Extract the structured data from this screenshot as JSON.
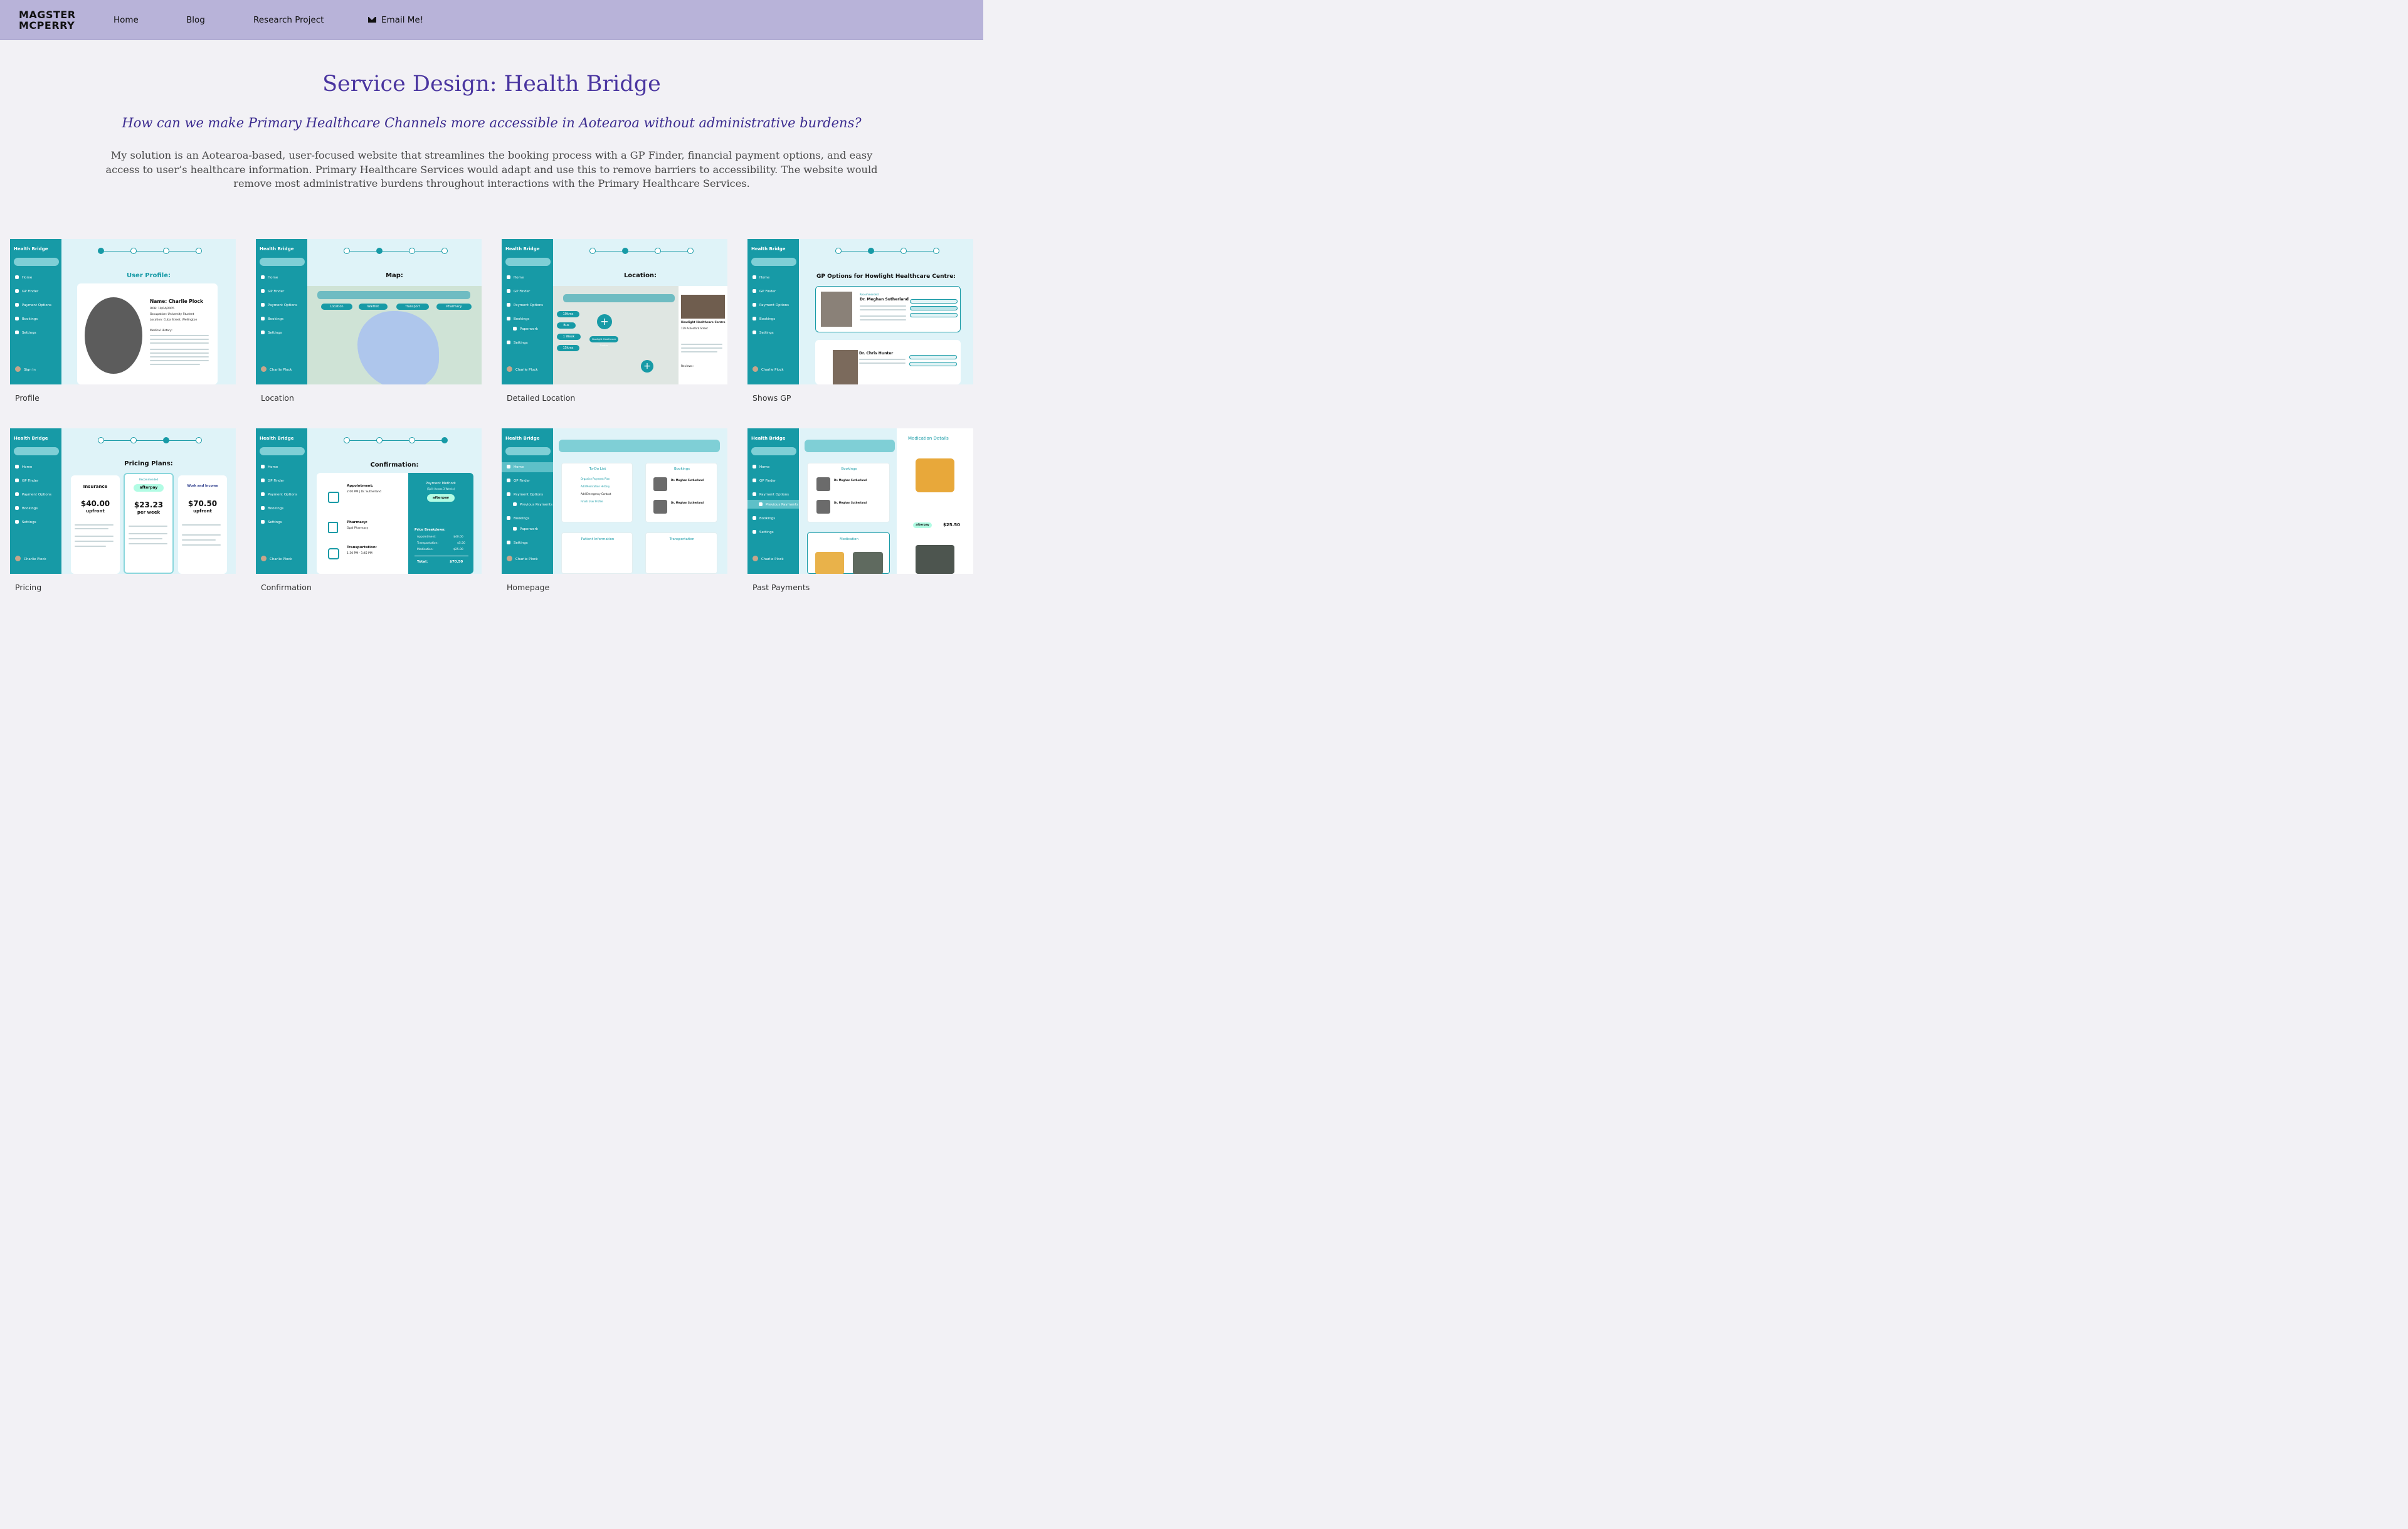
{
  "nav": {
    "logo_line1": "MAGSTER",
    "logo_line2": "MCPERRY",
    "home": "Home",
    "blog": "Blog",
    "research": "Research Project",
    "email": "Email Me!"
  },
  "page": {
    "title": "Service Design: Health Bridge",
    "question": "How can we make Primary Healthcare Channels more accessible in Aotearoa without administrative burdens?",
    "description": "My solution is an Aotearoa-based, user-focused website that streamlines the booking process with a GP Finder, financial payment options, and easy access to user’s healthcare information. Primary Healthcare Services would adapt and use this to remove barriers to accessibility. The website would remove most administrative burdens throughout interactions with the Primary Healthcare Services."
  },
  "app": {
    "brand": "Health Bridge",
    "search": "Search",
    "home": "Home",
    "gp_finder": "GP Finder",
    "payment": "Payment Options",
    "bookings": "Bookings",
    "settings": "Settings",
    "sign_in": "Sign In",
    "user": "Charlie Plock",
    "paperwork": "Paperwork",
    "prev_payments": "Previous Payments",
    "step1": "Sign Up",
    "step2": "Find a GP",
    "step3": "Pricing Plans",
    "step4": "Confirmation"
  },
  "screens": {
    "profile": {
      "caption": "Profile",
      "heading": "User Profile:",
      "name": "Name: Charlie Plock",
      "dob": "DOB: 19/04/2005",
      "occupation": "Occupation: University Student",
      "location": "Location: Cuba Street, Wellington",
      "history": "Medical History:"
    },
    "location": {
      "caption": "Location",
      "heading": "Map:",
      "f1": "Location",
      "f2": "Waitlist",
      "f3": "Transport",
      "f4": "Pharmacy"
    },
    "detailed": {
      "caption": "Detailed Location",
      "heading": "Location:",
      "d1": "10kms",
      "d2": "Bus",
      "d3": "1 Week",
      "d4": "15kms",
      "pin": "Howlight Healthcare Centre",
      "place": "Howlight Healthcare Centre",
      "addr": "129 Ashenford Street",
      "reviews": "Reviews:"
    },
    "gp": {
      "caption": "Shows GP",
      "heading": "GP Options for Howlight Healthcare Centre:",
      "rec": "Recommended",
      "doc1": "Dr. Meghan Sutherland",
      "doc2": "Dr. Chris Hunter"
    },
    "pricing": {
      "caption": "Pricing",
      "heading": "Pricing Plans:",
      "rec": "Recommended",
      "brand1": "Insurance",
      "price1": "$40.00",
      "unit1": "upfront",
      "brand2": "afterpay",
      "price2": "$23.23",
      "unit2": "per week",
      "brand3": "Work and Income",
      "price3": "$70.50",
      "unit3": "upfront"
    },
    "confirmation": {
      "caption": "Confirmation",
      "heading": "Confirmation:",
      "appt": "Appointment:",
      "appt_time": "2:00 PM | Dr. Sutherland",
      "pharm": "Pharmacy:",
      "pharm_name": "Opal Pharmacy",
      "trans": "Transportation:",
      "trans_time": "1:30 PM - 1:45 PM",
      "method": "Payment Method:",
      "split": "(Split Across 3 Weeks)",
      "brand": "afterpay",
      "breakdown": "Price Breakdown:",
      "total_label": "Total:",
      "total": "$70.50",
      "r1": "Appointment:",
      "v1": "$40.00",
      "r2": "Transportation:",
      "v2": "$5.50",
      "r3": "Medication:",
      "v3": "$25.00"
    },
    "homepage": {
      "caption": "Homepage",
      "todo": "To-Do List",
      "bookings": "Bookings",
      "patient": "Patient Information",
      "transport": "Transportation",
      "doc": "Dr. Meghan Sutherland",
      "t1": "Organise Payment Plan",
      "t2": "Add Medication History",
      "t3": "Add Emergency Contact",
      "t4": "Finish User Profile"
    },
    "past": {
      "caption": "Past Payments",
      "bookings": "Bookings",
      "med": "Medication",
      "details": "Medication Details",
      "doc": "Dr. Meghan Sutherland",
      "amount": "$25.50",
      "brand": "afterpay"
    }
  },
  "colors": {
    "nav": "#b8b3d9",
    "title": "#4a35a0",
    "teal": "#179aa6"
  }
}
